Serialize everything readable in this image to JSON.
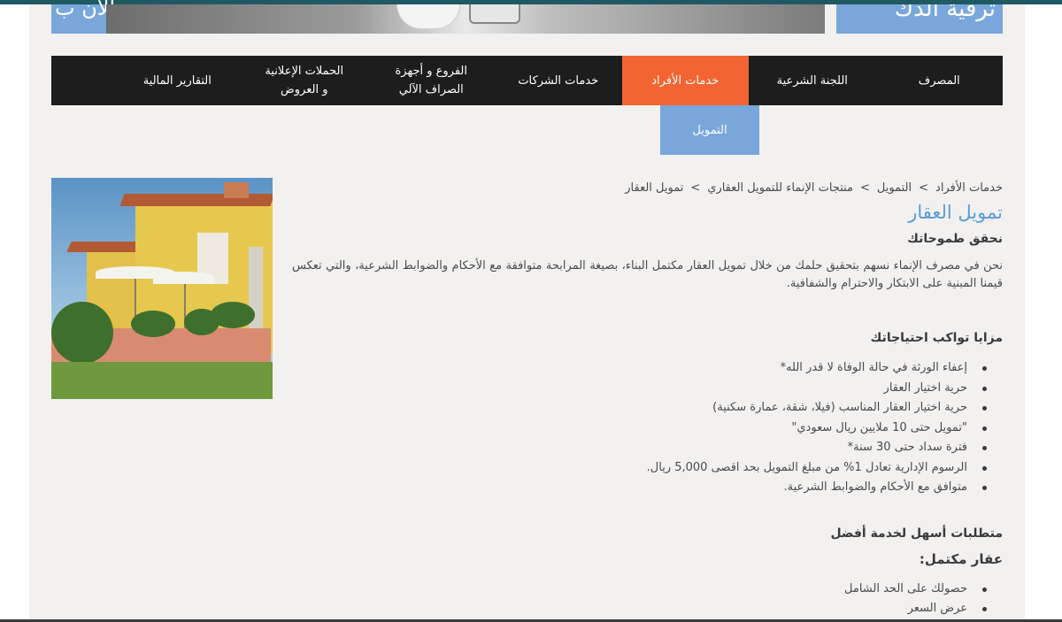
{
  "banner": {
    "left_text": "الآن ب",
    "right_text": "ترقية الدك"
  },
  "nav": {
    "items": [
      {
        "label": "المصرف",
        "active": false
      },
      {
        "label": "اللجنة الشرعية",
        "active": false
      },
      {
        "label": "خدمات الأفراد",
        "active": true
      },
      {
        "label": "خدمات الشركات",
        "active": false
      },
      {
        "label": "الفروع و أجهزة\nالصراف الآلي",
        "active": false
      },
      {
        "label": "الحملات الإعلانية\nو العروض",
        "active": false
      },
      {
        "label": "التقارير المالية",
        "active": false
      }
    ],
    "submenu_label": "التمويل",
    "colors": {
      "bar": "#1d1d1d",
      "active": "#f26532",
      "submenu": "#7aa7db"
    }
  },
  "breadcrumb": {
    "items": [
      "خدمات الأفراد",
      "التمويل",
      "منتجات الإنماء للتمويل العقاري",
      "تمويل العقار"
    ],
    "separator": ">"
  },
  "content": {
    "title": "تمويل العقار",
    "subtitle": "نحقق طموحاتك",
    "intro": "نحن في مصرف الإنماء نسهم بتحقيق حلمك من خلال تمويل العقار مكتمل البناء، بصيغة المرابحة متوافقة مع الأحكام والضوابط الشرعية، والتي تعكس قيمنا المبنية على الابتكار والاحترام والشفافية.",
    "features_title": "مزايا تواكب احتياجاتك",
    "features": [
      "إعفاء الورثة في حالة الوفاة لا قدر الله*",
      "حرية اختيار العقار",
      "حرية اختيار العقار المناسب (فيلا، شقة، عمارة سكنية)",
      "\"تمويل حتى 10 ملايين ريال سعودي\"",
      "فترة سداد حتى 30 سنة*",
      "الرسوم الإدارية تعادل 1% من مبلغ التمويل بحد اقصى 5,000 ريال.",
      "متوافق مع الأحكام والضوابط الشرعية."
    ],
    "requirements_title": "متطلبات أسهل لخدمة أفضل",
    "requirements_sub": "عقار مكتمل:",
    "requirements": [
      "حصولك على الحد الشامل",
      "عرض السعر"
    ],
    "title_color": "#5b9bd8"
  }
}
